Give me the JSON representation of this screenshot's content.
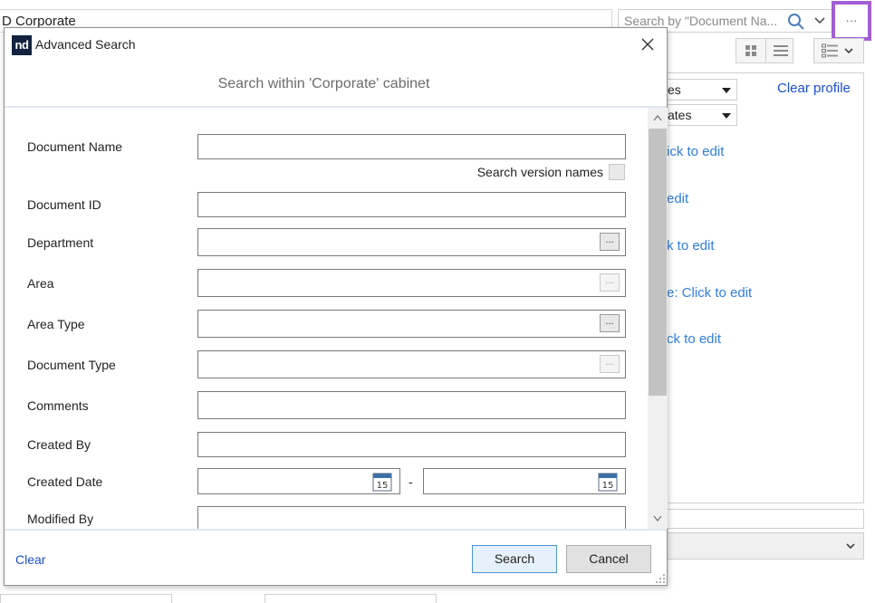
{
  "background": {
    "title": "D Corporate",
    "search_placeholder": "Search by \"Document Na...",
    "more_label": "···",
    "profile_dropdowns": [
      "es",
      "ates"
    ],
    "clear_profile": "Clear profile",
    "edit_links": [
      "ick to edit",
      "edit",
      "k to edit",
      "e: Click to edit",
      "ck to edit"
    ]
  },
  "dialog": {
    "logo_text": "nd",
    "title": "Advanced Search",
    "subtitle": "Search within 'Corporate' cabinet",
    "fields": {
      "document_name": "Document Name",
      "search_version_names": "Search version names",
      "document_id": "Document ID",
      "department": "Department",
      "area": "Area",
      "area_type": "Area Type",
      "document_type": "Document Type",
      "comments": "Comments",
      "created_by": "Created By",
      "created_date": "Created Date",
      "modified_by": "Modified By"
    },
    "lookup_label": "...",
    "date_separator": "-",
    "calendar_day": "15",
    "clear_label": "Clear",
    "search_label": "Search",
    "cancel_label": "Cancel"
  },
  "colors": {
    "link": "#1a4fd1",
    "edit_link": "#2f7fe0",
    "highlight": "#a35ed6",
    "primary_button_border": "#4a90d9",
    "logo_bg": "#13233f"
  },
  "icons": [
    "search-icon",
    "chevron-down-icon",
    "grid-view-icon",
    "list-view-icon",
    "detail-view-icon",
    "close-icon",
    "calendar-icon",
    "scroll-up-icon",
    "scroll-down-icon",
    "resize-grip-icon"
  ]
}
